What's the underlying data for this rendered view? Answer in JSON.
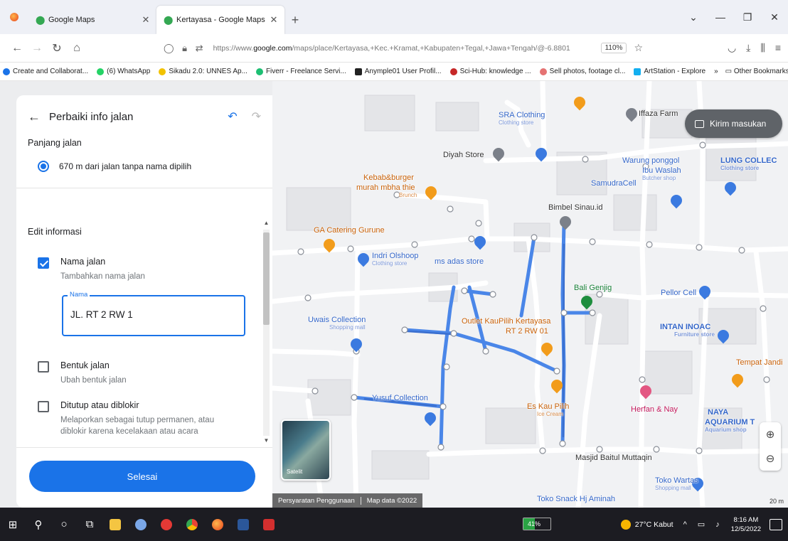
{
  "browser": {
    "tabs": [
      {
        "label": "Google Maps",
        "active": false
      },
      {
        "label": "Kertayasa - Google Maps",
        "active": true
      }
    ],
    "new_tab": "+",
    "url_prefix": "https://www.",
    "url_domain": "google.com",
    "url_rest": "/maps/place/Kertayasa,+Kec.+Kramat,+Kabupaten+Tegal,+Jawa+Tengah/@-6.8801",
    "zoom": "110%",
    "bookmarks": [
      {
        "label": "Create and Collaborat...",
        "color": "#1a73e8"
      },
      {
        "label": "(6) WhatsApp",
        "color": "#25d366"
      },
      {
        "label": "Sikadu 2.0: UNNES Ap...",
        "color": "#f2c200"
      },
      {
        "label": "Fiverr - Freelance Servi...",
        "color": "#1dbf73"
      },
      {
        "label": "Anymple01 User Profil...",
        "color": "#222222"
      },
      {
        "label": "Sci-Hub: knowledge ...",
        "color": "#c62828"
      },
      {
        "label": "Sell photos, footage cl...",
        "color": "#e57373"
      },
      {
        "label": "ArtStation - Explore",
        "color": "#13aff0"
      }
    ],
    "bookmarks_more": "»",
    "other_bookmarks": "Other Bookmarks"
  },
  "panel": {
    "title": "Perbaiki info jalan",
    "panjang_title": "Panjang jalan",
    "panjang_value": "670 m dari jalan tanpa nama dipilih",
    "edit_title": "Edit informasi",
    "nama": {
      "label": "Nama jalan",
      "sub": "Tambahkan nama jalan",
      "checked": true
    },
    "name_field": {
      "label": "Nama",
      "value": "JL. RT 2 RW 1"
    },
    "bentuk": {
      "label": "Bentuk jalan",
      "sub": "Ubah bentuk jalan",
      "checked": false
    },
    "ditutup": {
      "label": "Ditutup atau diblokir",
      "sub": "Melaporkan sebagai tutup permanen, atau diblokir karena kecelakaan atau acara",
      "checked": false
    },
    "done_label": "Selesai"
  },
  "map": {
    "feedback_label": "Kirim masukan",
    "satellite_label": "Satelit",
    "footer_terms": "Persyaratan Penggunaan",
    "footer_data": "Map data ©2022",
    "scale": "20 m",
    "places": [
      {
        "text": "SRA Clothing",
        "sub": "Clothing store",
        "style": "blue"
      },
      {
        "text": "Diyah Store",
        "sub": "",
        "style": "dark"
      },
      {
        "text": "Iffaza Farm",
        "sub": "",
        "style": "dark"
      },
      {
        "text": "Warung ponggol",
        "sub": "",
        "style": "blue"
      },
      {
        "text": "Ibu Waslah",
        "sub": "Butcher shop",
        "style": "blue"
      },
      {
        "text": "LUNG COLLEC",
        "sub": "Clothing store",
        "style": "blue"
      },
      {
        "text": "SamudraCell",
        "sub": "",
        "style": "blue"
      },
      {
        "text": "Kebab&burger",
        "sub": "",
        "style": "orange"
      },
      {
        "text": "murah mbha thie",
        "sub": "Brunch",
        "style": "orange"
      },
      {
        "text": "Bimbel Sinau.id",
        "sub": "",
        "style": "dark"
      },
      {
        "text": "GA Catering Gurune",
        "sub": "",
        "style": "orange"
      },
      {
        "text": "Indri Olshoop",
        "sub": "Clothing store",
        "style": "blue"
      },
      {
        "text": "ms adas store",
        "sub": "",
        "style": "blue"
      },
      {
        "text": "Bali Genjig",
        "sub": "",
        "style": "green"
      },
      {
        "text": "Pellor Cell",
        "sub": "",
        "style": "blue"
      },
      {
        "text": "Uwais Collection",
        "sub": "Shopping mall",
        "style": "blue"
      },
      {
        "text": "Outlet KauPilih Kertayasa",
        "sub": "",
        "style": "orange"
      },
      {
        "text": "RT 2 RW 01",
        "sub": "",
        "style": "orange"
      },
      {
        "text": "INTAN INOAC",
        "sub": "Furniture store",
        "style": "blue"
      },
      {
        "text": "Tempat Jandi",
        "sub": "",
        "style": "orange"
      },
      {
        "text": "Yusuf Collection",
        "sub": "",
        "style": "blue"
      },
      {
        "text": "Es Kau Pilih",
        "sub": "Ice Cream",
        "style": "orange"
      },
      {
        "text": "Herfan & Nay",
        "sub": "",
        "style": "pink"
      },
      {
        "text": "NAYA",
        "sub": "",
        "style": "blue"
      },
      {
        "text": "AQUARIUM T",
        "sub": "Aquarium shop",
        "style": "blue"
      },
      {
        "text": "Masjid Baitul Muttaqin",
        "sub": "",
        "style": "dark"
      },
      {
        "text": "Toko Wartas",
        "sub": "Shopping mall",
        "style": "blue"
      },
      {
        "text": "Toko Snack Hj Aminah",
        "sub": "",
        "style": "blue"
      }
    ]
  },
  "taskbar": {
    "battery": "41%",
    "battery_level": 0.41,
    "weather": "27°C  Kabut",
    "time": "8:16 AM",
    "date": "12/5/2022"
  }
}
